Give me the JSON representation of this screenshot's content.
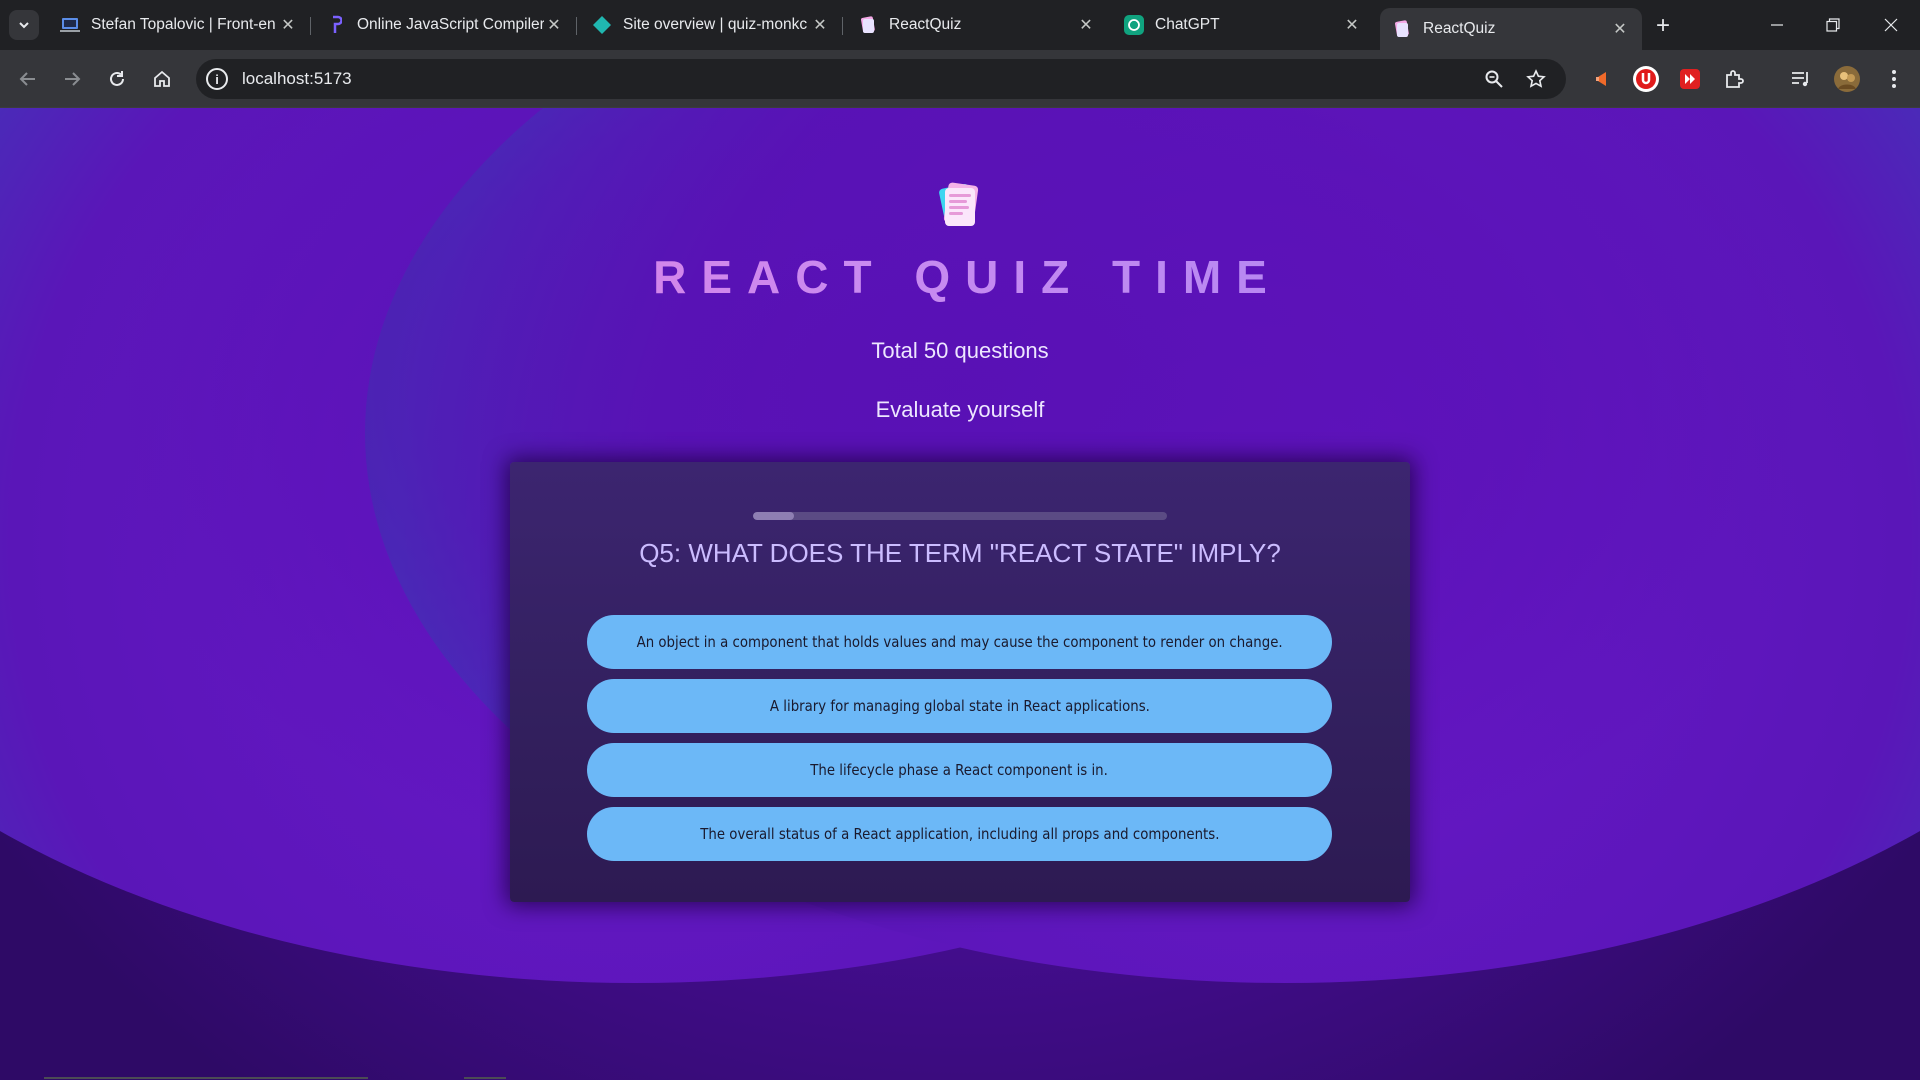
{
  "browser": {
    "tabs": [
      {
        "title": "Stefan Topalovic | Front-en",
        "icon": "laptop-favicon",
        "active": false
      },
      {
        "title": "Online JavaScript Compiler",
        "icon": "compiler-favicon",
        "active": false
      },
      {
        "title": "Site overview | quiz-monkc",
        "icon": "netlify-favicon",
        "active": false
      },
      {
        "title": "ReactQuiz",
        "icon": "reactquiz-favicon",
        "active": false
      },
      {
        "title": "ChatGPT",
        "icon": "chatgpt-favicon",
        "active": false
      },
      {
        "title": "ReactQuiz",
        "icon": "reactquiz-favicon",
        "active": true
      }
    ],
    "address": "localhost:5173",
    "colors": {
      "tabstrip": "#202124",
      "toolbar": "#35363a"
    }
  },
  "app": {
    "title": "REACT QUIZ TIME",
    "total_questions": "Total 50 questions",
    "tagline": "Evaluate yourself",
    "progress_fraction": 0.1,
    "question": "Q5: What does the term \"React state\" imply?",
    "answers": [
      "An object in a component that holds values and may cause the component to render on change.",
      "A library for managing global state in React applications.",
      "The lifecycle phase a React component is in.",
      "The overall status of a React application, including all props and components."
    ],
    "colors": {
      "answer_bg": "#6cb8f7",
      "question_text": "#cbbcff",
      "card_bg": "#33205f"
    }
  }
}
